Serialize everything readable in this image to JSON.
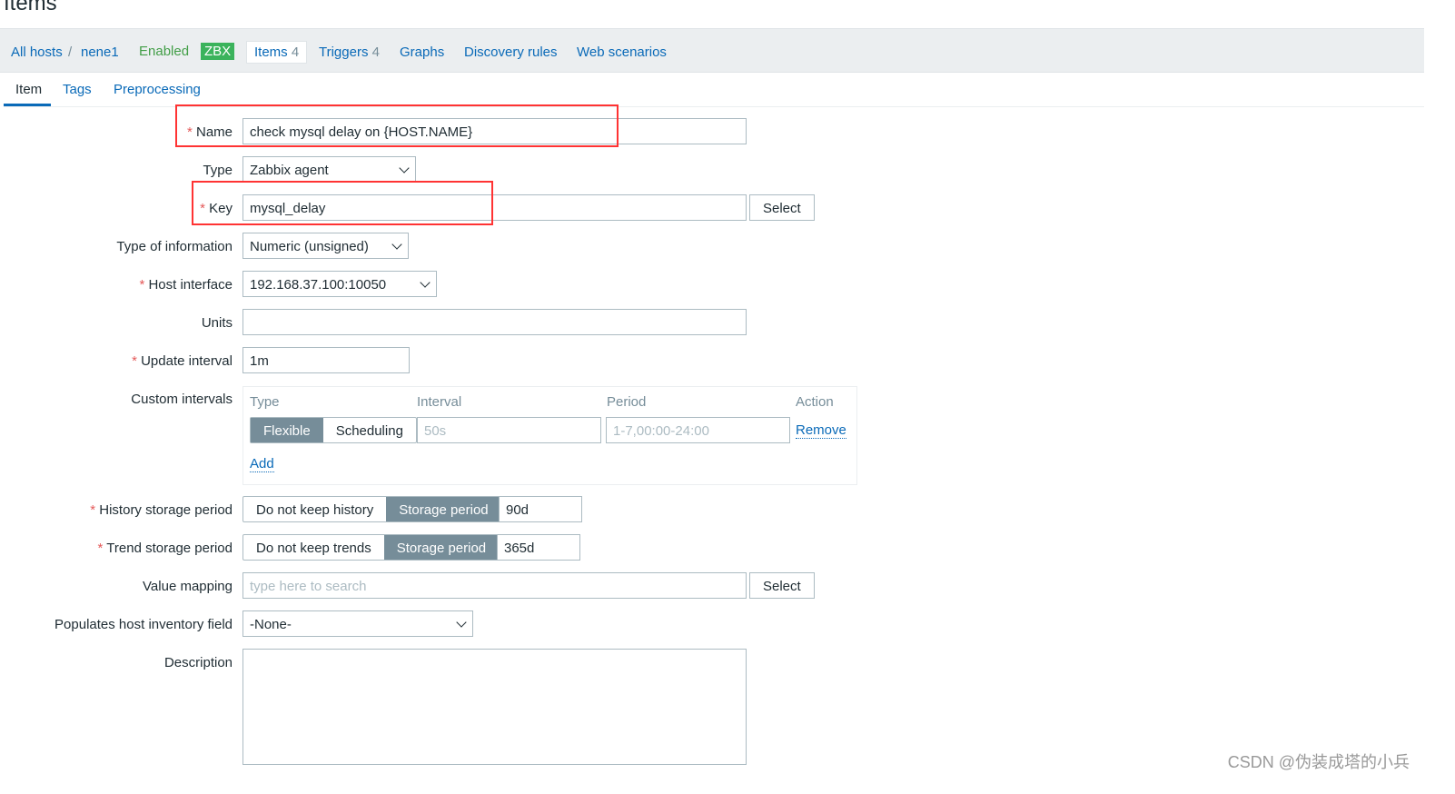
{
  "page_title": "Items",
  "nav": {
    "all_hosts": "All hosts",
    "separator": "/",
    "host": "nene1",
    "status": "Enabled",
    "zbx": "ZBX",
    "items": "Items",
    "items_count": "4",
    "triggers": "Triggers",
    "triggers_count": "4",
    "graphs": "Graphs",
    "discovery": "Discovery rules",
    "web": "Web scenarios"
  },
  "tabs": [
    "Item",
    "Tags",
    "Preprocessing"
  ],
  "form": {
    "required_mark": "*",
    "name_label": "Name",
    "name_value": "check mysql delay on {HOST.NAME}",
    "type_label": "Type",
    "type_value": "Zabbix agent",
    "key_label": "Key",
    "key_value": "mysql_delay",
    "select_label": "Select",
    "type_info_label": "Type of information",
    "type_info_value": "Numeric (unsigned)",
    "host_interface_label": "Host interface",
    "host_interface_value": "192.168.37.100:10050",
    "units_label": "Units",
    "units_value": "",
    "update_label": "Update interval",
    "update_value": "1m",
    "custom_label": "Custom intervals",
    "custom": {
      "headers": [
        "Type",
        "Interval",
        "Period",
        "Action"
      ],
      "flexible": "Flexible",
      "scheduling": "Scheduling",
      "interval_placeholder": "50s",
      "period_placeholder": "1-7,00:00-24:00",
      "remove": "Remove",
      "add": "Add"
    },
    "history_label": "History storage period",
    "history_off": "Do not keep history",
    "history_on": "Storage period",
    "history_value": "90d",
    "trend_label": "Trend storage period",
    "trend_off": "Do not keep trends",
    "trend_on": "Storage period",
    "trend_value": "365d",
    "valuemap_label": "Value mapping",
    "valuemap_placeholder": "type here to search",
    "inventory_label": "Populates host inventory field",
    "inventory_value": "-None-",
    "description_label": "Description"
  },
  "watermark": "CSDN @伪装成塔的小兵",
  "colors": {
    "link": "#0a6ab8",
    "accent_button": "#768d99",
    "annotation_box": "#ff3333",
    "zbx_badge": "#3bb35c"
  }
}
